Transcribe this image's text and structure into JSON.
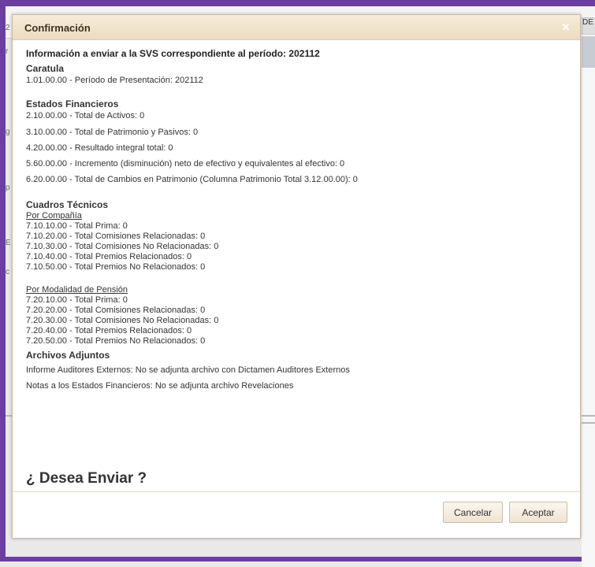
{
  "background": {
    "right_header": "DE",
    "left_fragments": [
      "2",
      "r",
      "g",
      "p",
      "E",
      "c"
    ]
  },
  "dialog": {
    "title": "Confirmación",
    "close_label": "×",
    "heading": "Información a enviar a la SVS correspondiente al período: 202112",
    "caratula": {
      "title": "Caratula",
      "lines": [
        "1.01.00.00 - Período de Presentación: 202112"
      ]
    },
    "estados": {
      "title": "Estados Financieros",
      "lines": [
        "2.10.00.00 - Total de Activos: 0",
        "3.10.00.00 - Total de Patrimonio y Pasivos: 0",
        "4.20.00.00 - Resultado integral total: 0",
        "5.60.00.00 - Incremento (disminución) neto de efectivo y equivalentes al efectivo: 0",
        "6.20.00.00 - Total de Cambios en Patrimonio (Columna Patrimonio Total 3.12.00.00): 0"
      ]
    },
    "cuadros": {
      "title": "Cuadros Técnicos",
      "por_compania": {
        "title": "Por Compañía",
        "lines": [
          "7.10.10.00 - Total Prima: 0",
          "7.10.20.00 - Total Comisiones Relacionadas: 0",
          "7.10.30.00 - Total Comisiones No Relacionadas: 0",
          "7.10.40.00 - Total Premios Relacionados: 0",
          "7.10.50.00 - Total Premios No Relacionados: 0"
        ]
      },
      "por_modalidad": {
        "title": "Por Modalidad de Pensión",
        "lines": [
          "7.20.10.00 - Total Prima: 0",
          "7.20.20.00 - Total Comisiones Relacionadas: 0",
          "7.20.30.00 - Total Comisiones No Relacionadas: 0",
          "7.20.40.00 - Total Premios Relacionados: 0",
          "7.20.50.00 - Total Premios No Relacionados: 0"
        ]
      }
    },
    "archivos": {
      "title": "Archivos Adjuntos",
      "lines": [
        "Informe Auditores Externos: No se adjunta archivo con Dictamen Auditores Externos",
        "Notas a los Estados Financieros: No se adjunta archivo Revelaciones"
      ]
    },
    "question": "¿ Desea Enviar ?",
    "buttons": {
      "cancel": "Cancelar",
      "accept": "Aceptar"
    }
  },
  "colors": {
    "frame": "#6a3fa0",
    "titlebar": "#f1e4cc",
    "title_text": "#3e3126"
  }
}
